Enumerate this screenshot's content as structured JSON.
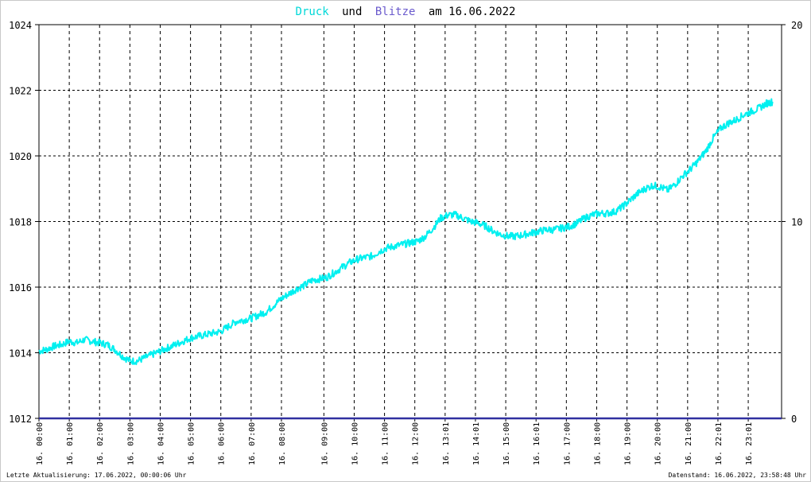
{
  "title": {
    "part1": "Druck",
    "part2": "und",
    "part3": "Blitze",
    "part4": "am 16.06.2022"
  },
  "colors": {
    "pressure": "#00f0f0",
    "lightning": "#3030a0",
    "grid": "#000000",
    "title_accent_1": "#00d8d8",
    "title_accent_2": "#6a5acd",
    "text": "#000000"
  },
  "footer": {
    "left": "Letzte Aktualisierung: 17.06.2022, 00:00:06 Uhr",
    "right": "Datenstand: 16.06.2022, 23:58:48 Uhr"
  },
  "chart_data": {
    "type": "line",
    "title": "Druck und Blitze am 16.06.2022",
    "y_left": {
      "min": 1012,
      "max": 1024,
      "ticks": [
        "1012",
        "1014",
        "1016",
        "1018",
        "1020",
        "1022",
        "1024"
      ]
    },
    "y_right": {
      "min": 0,
      "max": 20,
      "ticks": [
        "0",
        "10",
        "20"
      ]
    },
    "x_ticks": [
      {
        "label": "16. 00:00",
        "t": 0.0
      },
      {
        "label": "16. 01:00",
        "t": 1.0
      },
      {
        "label": "16. 02:00",
        "t": 2.0
      },
      {
        "label": "16. 03:00",
        "t": 3.0
      },
      {
        "label": "16. 04:00",
        "t": 4.0
      },
      {
        "label": "16. 05:00",
        "t": 5.0
      },
      {
        "label": "16. 06:00",
        "t": 6.0
      },
      {
        "label": "16. 07:00",
        "t": 7.0
      },
      {
        "label": "16. 08:00",
        "t": 8.0
      },
      {
        "label": "16. 09:00",
        "t": 9.4
      },
      {
        "label": "16. 10:00",
        "t": 10.4
      },
      {
        "label": "16. 11:00",
        "t": 11.4
      },
      {
        "label": "16. 12:00",
        "t": 12.4
      },
      {
        "label": "16. 13:01",
        "t": 13.4
      },
      {
        "label": "16. 14:01",
        "t": 14.4
      },
      {
        "label": "16. 15:00",
        "t": 15.4
      },
      {
        "label": "16. 16:01",
        "t": 16.4
      },
      {
        "label": "16. 17:00",
        "t": 17.4
      },
      {
        "label": "16. 18:00",
        "t": 18.4
      },
      {
        "label": "16. 19:00",
        "t": 19.4
      },
      {
        "label": "16. 20:00",
        "t": 20.4
      },
      {
        "label": "16. 21:00",
        "t": 21.4
      },
      {
        "label": "16. 22:01",
        "t": 22.4
      },
      {
        "label": "16. 23:01",
        "t": 23.4
      }
    ],
    "x_range": [
      0,
      24.5
    ],
    "grid": true,
    "series": [
      {
        "name": "Druck",
        "axis": "left",
        "x": [
          0.0,
          0.25,
          0.5,
          0.75,
          1.0,
          1.25,
          1.5,
          1.75,
          2.0,
          2.25,
          2.5,
          2.75,
          3.0,
          3.25,
          3.5,
          3.75,
          4.0,
          4.25,
          4.5,
          4.75,
          5.0,
          5.25,
          5.5,
          5.75,
          6.0,
          6.25,
          6.5,
          6.75,
          7.0,
          7.25,
          7.5,
          7.75,
          8.0,
          8.25,
          8.5,
          8.75,
          9.0,
          9.25,
          9.5,
          9.75,
          10.0,
          10.25,
          10.5,
          10.75,
          11.0,
          11.25,
          11.5,
          11.75,
          12.0,
          12.25,
          12.5,
          12.75,
          13.0,
          13.25,
          13.5,
          13.75,
          14.0,
          14.25,
          14.5,
          14.75,
          15.0,
          15.25,
          15.5,
          15.75,
          16.0,
          16.25,
          16.5,
          16.75,
          17.0,
          17.25,
          17.5,
          17.75,
          18.0,
          18.25,
          18.5,
          18.75,
          19.0,
          19.25,
          19.5,
          19.75,
          20.0,
          20.25,
          20.5,
          20.75,
          21.0,
          21.25,
          21.5,
          21.75,
          22.0,
          22.25,
          22.5,
          22.75,
          23.0,
          23.25,
          23.5,
          23.75,
          24.0,
          24.2
        ],
        "values": [
          1014.05,
          1014.1,
          1014.2,
          1014.25,
          1014.35,
          1014.3,
          1014.4,
          1014.35,
          1014.3,
          1014.25,
          1014.1,
          1013.9,
          1013.75,
          1013.75,
          1013.85,
          1013.95,
          1014.05,
          1014.15,
          1014.25,
          1014.35,
          1014.45,
          1014.5,
          1014.55,
          1014.6,
          1014.65,
          1014.8,
          1014.95,
          1015.0,
          1015.05,
          1015.15,
          1015.25,
          1015.45,
          1015.65,
          1015.8,
          1015.95,
          1016.05,
          1016.2,
          1016.25,
          1016.3,
          1016.45,
          1016.6,
          1016.75,
          1016.85,
          1016.9,
          1016.95,
          1017.1,
          1017.2,
          1017.25,
          1017.3,
          1017.35,
          1017.4,
          1017.55,
          1017.8,
          1018.1,
          1018.2,
          1018.2,
          1018.1,
          1018.0,
          1017.95,
          1017.85,
          1017.7,
          1017.6,
          1017.55,
          1017.55,
          1017.6,
          1017.65,
          1017.7,
          1017.75,
          1017.75,
          1017.8,
          1017.85,
          1017.95,
          1018.1,
          1018.2,
          1018.25,
          1018.25,
          1018.3,
          1018.45,
          1018.65,
          1018.85,
          1019.0,
          1019.1,
          1019.05,
          1018.95,
          1019.15,
          1019.4,
          1019.6,
          1019.85,
          1020.15,
          1020.55,
          1020.85,
          1021.0,
          1021.1,
          1021.25,
          1021.35,
          1021.45,
          1021.6,
          1021.65
        ]
      },
      {
        "name": "Blitze",
        "axis": "right",
        "x": [
          0.0,
          24.5
        ],
        "values": [
          0,
          0
        ]
      }
    ]
  }
}
